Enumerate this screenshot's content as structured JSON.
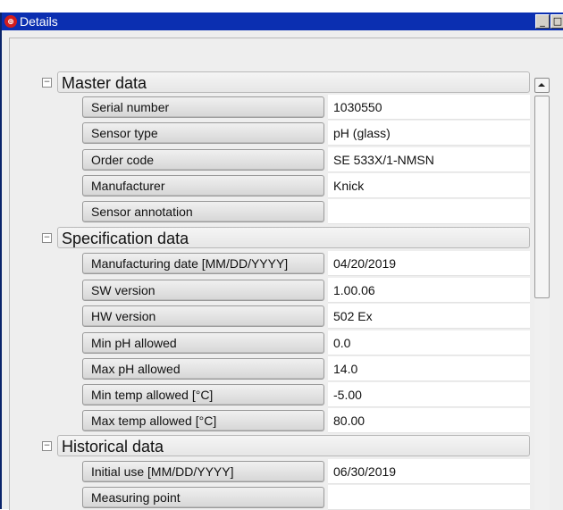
{
  "window": {
    "title": "Details",
    "minimize_label": "_",
    "maximize_label": "□",
    "close_label": "✕"
  },
  "sections": [
    {
      "title": "Master data",
      "rows": [
        {
          "label": "Serial number",
          "value": "1030550"
        },
        {
          "label": "Sensor type",
          "value": "pH (glass)"
        },
        {
          "label": "Order code",
          "value": "SE 533X/1-NMSN"
        },
        {
          "label": "Manufacturer",
          "value": "Knick"
        },
        {
          "label": "Sensor annotation",
          "value": ""
        }
      ]
    },
    {
      "title": "Specification data",
      "rows": [
        {
          "label": "Manufacturing date [MM/DD/YYYY]",
          "value": "04/20/2019"
        },
        {
          "label": "SW version",
          "value": "1.00.06"
        },
        {
          "label": "HW version",
          "value": "502 Ex"
        },
        {
          "label": "Min pH allowed",
          "value": "0.0"
        },
        {
          "label": "Max pH allowed",
          "value": "14.0"
        },
        {
          "label": "Min temp allowed [°C]",
          "value": "-5.00"
        },
        {
          "label": "Max temp allowed [°C]",
          "value": "80.00"
        }
      ]
    },
    {
      "title": "Historical data",
      "rows": [
        {
          "label": "Initial use [MM/DD/YYYY]",
          "value": "06/30/2019"
        },
        {
          "label": "Measuring point",
          "value": ""
        }
      ]
    }
  ]
}
